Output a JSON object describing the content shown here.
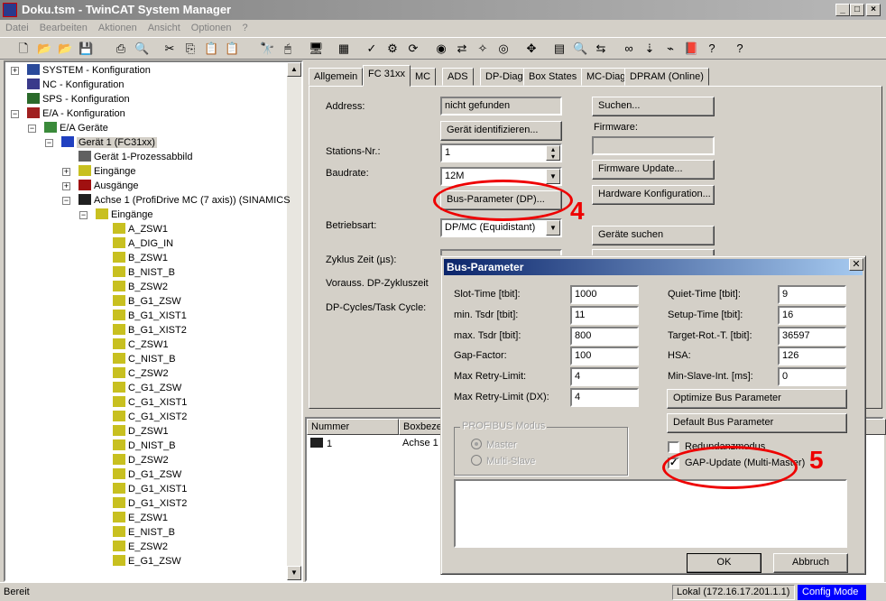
{
  "window": {
    "title": "Doku.tsm - TwinCAT System Manager",
    "controls": [
      "_",
      "□",
      "×"
    ]
  },
  "menu": [
    "Datei",
    "Bearbeiten",
    "Aktionen",
    "Ansicht",
    "Optionen",
    "?"
  ],
  "toolbar": [
    {
      "icon": "new-icon",
      "glyph": "🗋"
    },
    {
      "icon": "open-icon",
      "glyph": "📂"
    },
    {
      "icon": "open-remote-icon",
      "glyph": "📂"
    },
    {
      "icon": "save-icon",
      "glyph": "💾"
    },
    {
      "icon": "print-icon",
      "glyph": "⎙"
    },
    {
      "icon": "print-preview-icon",
      "glyph": "🔍"
    },
    {
      "icon": "cut-icon",
      "glyph": "✂"
    },
    {
      "icon": "copy-icon",
      "glyph": "⎘"
    },
    {
      "icon": "paste-icon",
      "glyph": "📋"
    },
    {
      "icon": "paste-with-links-icon",
      "glyph": "📋"
    },
    {
      "icon": "find-icon",
      "glyph": "🔭"
    },
    {
      "icon": "mouse-icon",
      "glyph": "🖱"
    },
    {
      "icon": "target-system-icon",
      "glyph": "🖥"
    },
    {
      "icon": "generate-mappings-icon",
      "glyph": "▦"
    },
    {
      "icon": "check-configuration-icon",
      "glyph": "✓"
    },
    {
      "icon": "activate-configuration-icon",
      "glyph": "⚙"
    },
    {
      "icon": "restart-config-mode-icon",
      "glyph": "⟳"
    },
    {
      "icon": "reload-devices-icon",
      "glyph": "◉"
    },
    {
      "icon": "scan-devices-icon",
      "glyph": "⇄"
    },
    {
      "icon": "toggle-free-run-icon",
      "glyph": "✧"
    },
    {
      "icon": "show-online-icon",
      "glyph": "◎"
    },
    {
      "icon": "select-in-tree-icon",
      "glyph": "✥"
    },
    {
      "icon": "table-icon",
      "glyph": "▤"
    },
    {
      "icon": "zoom-icon",
      "glyph": "🔍"
    },
    {
      "icon": "link-icon",
      "glyph": "⇆"
    },
    {
      "icon": "watch-icon",
      "glyph": "∞"
    },
    {
      "icon": "force-icon",
      "glyph": "⇣"
    },
    {
      "icon": "online-values-icon",
      "glyph": "⌁"
    },
    {
      "icon": "help-book-icon",
      "glyph": "📕"
    },
    {
      "icon": "help-icon",
      "glyph": "?"
    },
    {
      "icon": "whats-this-icon",
      "glyph": "?"
    }
  ],
  "tree": [
    {
      "label": "SYSTEM - Konfiguration",
      "level": 0,
      "expander": "+",
      "icon": "system-icon",
      "color": "#2a4a9a"
    },
    {
      "label": "NC - Konfiguration",
      "level": 0,
      "expander": "",
      "icon": "nc-icon",
      "color": "#3a3a8a"
    },
    {
      "label": "SPS - Konfiguration",
      "level": 0,
      "expander": "",
      "icon": "plc-icon",
      "color": "#2a6a2a"
    },
    {
      "label": "E/A - Konfiguration",
      "level": 0,
      "expander": "-",
      "icon": "io-config-icon",
      "color": "#a02020"
    },
    {
      "label": "E/A Geräte",
      "level": 1,
      "expander": "-",
      "icon": "io-devices-icon",
      "color": "#3a8a3a"
    },
    {
      "label": "Gerät 1 (FC31xx)",
      "level": 2,
      "expander": "-",
      "icon": "profibus-device-icon",
      "color": "#2040c0",
      "selected": true
    },
    {
      "label": "Gerät 1-Prozessabbild",
      "level": 3,
      "expander": "",
      "icon": "process-image-icon",
      "color": "#606060"
    },
    {
      "label": "Eingänge",
      "level": 3,
      "expander": "+",
      "icon": "inputs-icon",
      "color": "#c8c020"
    },
    {
      "label": "Ausgänge",
      "level": 3,
      "expander": "+",
      "icon": "outputs-icon",
      "color": "#a01010"
    },
    {
      "label": "Achse 1 (ProfiDrive MC (7 axis)) (SINAMICS",
      "level": 3,
      "expander": "-",
      "icon": "axis-box-icon",
      "color": "#202020"
    },
    {
      "label": "Eingänge",
      "level": 4,
      "expander": "-",
      "icon": "inputs-icon",
      "color": "#c8c020"
    },
    {
      "label": "A_ZSW1",
      "level": 5,
      "icon": "input-var-icon",
      "color": "#c8c020"
    },
    {
      "label": "A_DIG_IN",
      "level": 5,
      "icon": "input-var-icon",
      "color": "#c8c020"
    },
    {
      "label": "B_ZSW1",
      "level": 5,
      "icon": "input-var-icon",
      "color": "#c8c020"
    },
    {
      "label": "B_NIST_B",
      "level": 5,
      "icon": "input-var-icon",
      "color": "#c8c020"
    },
    {
      "label": "B_ZSW2",
      "level": 5,
      "icon": "input-var-icon",
      "color": "#c8c020"
    },
    {
      "label": "B_G1_ZSW",
      "level": 5,
      "icon": "input-var-icon",
      "color": "#c8c020"
    },
    {
      "label": "B_G1_XIST1",
      "level": 5,
      "icon": "input-var-icon",
      "color": "#c8c020"
    },
    {
      "label": "B_G1_XIST2",
      "level": 5,
      "icon": "input-var-icon",
      "color": "#c8c020"
    },
    {
      "label": "C_ZSW1",
      "level": 5,
      "icon": "input-var-icon",
      "color": "#c8c020"
    },
    {
      "label": "C_NIST_B",
      "level": 5,
      "icon": "input-var-icon",
      "color": "#c8c020"
    },
    {
      "label": "C_ZSW2",
      "level": 5,
      "icon": "input-var-icon",
      "color": "#c8c020"
    },
    {
      "label": "C_G1_ZSW",
      "level": 5,
      "icon": "input-var-icon",
      "color": "#c8c020"
    },
    {
      "label": "C_G1_XIST1",
      "level": 5,
      "icon": "input-var-icon",
      "color": "#c8c020"
    },
    {
      "label": "C_G1_XIST2",
      "level": 5,
      "icon": "input-var-icon",
      "color": "#c8c020"
    },
    {
      "label": "D_ZSW1",
      "level": 5,
      "icon": "input-var-icon",
      "color": "#c8c020"
    },
    {
      "label": "D_NIST_B",
      "level": 5,
      "icon": "input-var-icon",
      "color": "#c8c020"
    },
    {
      "label": "D_ZSW2",
      "level": 5,
      "icon": "input-var-icon",
      "color": "#c8c020"
    },
    {
      "label": "D_G1_ZSW",
      "level": 5,
      "icon": "input-var-icon",
      "color": "#c8c020"
    },
    {
      "label": "D_G1_XIST1",
      "level": 5,
      "icon": "input-var-icon",
      "color": "#c8c020"
    },
    {
      "label": "D_G1_XIST2",
      "level": 5,
      "icon": "input-var-icon",
      "color": "#c8c020"
    },
    {
      "label": "E_ZSW1",
      "level": 5,
      "icon": "input-var-icon",
      "color": "#c8c020"
    },
    {
      "label": "E_NIST_B",
      "level": 5,
      "icon": "input-var-icon",
      "color": "#c8c020"
    },
    {
      "label": "E_ZSW2",
      "level": 5,
      "icon": "input-var-icon",
      "color": "#c8c020"
    },
    {
      "label": "E_G1_ZSW",
      "level": 5,
      "icon": "input-var-icon",
      "color": "#c8c020"
    }
  ],
  "tabs": {
    "items": [
      "Allgemein",
      "FC 31xx",
      "MC",
      "ADS",
      "DP-Diag",
      "Box States",
      "MC-Diag",
      "DPRAM (Online)"
    ],
    "active": "FC 31xx"
  },
  "fc31xx": {
    "address_label": "Address:",
    "address_value": "nicht gefunden",
    "identify_button": "Gerät identifizieren...",
    "station_label": "Stations-Nr.:",
    "station_value": "1",
    "baudrate_label": "Baudrate:",
    "baudrate_value": "12M",
    "bus_param_button": "Bus-Parameter (DP)...",
    "mode_label": "Betriebsart:",
    "mode_value": "DP/MC (Equidistant)",
    "cycle_label": "Zyklus Zeit (µs):",
    "expected_cycle_label": "Vorauss. DP-Zykluszeit",
    "dp_cycles_label": "DP-Cycles/Task Cycle:",
    "search_button": "Suchen...",
    "firmware_label": "Firmware:",
    "firmware_value": "",
    "firmware_update_button": "Firmware Update...",
    "hw_config_button": "Hardware Konfiguration...",
    "find_devices_button": "Geräte suchen"
  },
  "box_list": {
    "columns": [
      "Nummer",
      "Boxbeze"
    ],
    "rows": [
      {
        "number": "1",
        "name": "Achse 1"
      }
    ]
  },
  "dialog": {
    "title": "Bus-Parameter",
    "left_fields": [
      {
        "label": "Slot-Time [tbit]:",
        "value": "1000"
      },
      {
        "label": "min. Tsdr [tbit]:",
        "value": "11"
      },
      {
        "label": "max. Tsdr [tbit]:",
        "value": "800"
      },
      {
        "label": "Gap-Factor:",
        "value": "100"
      },
      {
        "label": "Max Retry-Limit:",
        "value": "4"
      },
      {
        "label": "Max Retry-Limit (DX):",
        "value": "4"
      }
    ],
    "right_fields": [
      {
        "label": "Quiet-Time [tbit]:",
        "value": "9"
      },
      {
        "label": "Setup-Time [tbit]:",
        "value": "16"
      },
      {
        "label": "Target-Rot.-T. [tbit]:",
        "value": "36597"
      },
      {
        "label": "HSA:",
        "value": "126"
      },
      {
        "label": "Min-Slave-Int. [ms]:",
        "value": "0"
      }
    ],
    "optimize_button": "Optimize Bus Parameter",
    "default_button": "Default Bus Parameter",
    "profibus_group": "PROFIBUS Modus",
    "radio_master": "Master",
    "radio_multislave": "Multi-Slave",
    "radio_selected": "Master",
    "redundancy_label": "Redundanzmodus",
    "redundancy_checked": false,
    "gap_update_label": "GAP-Update (Multi-Master)",
    "gap_update_checked": true,
    "ok_button": "OK",
    "cancel_button": "Abbruch"
  },
  "annotations": {
    "step4": "4",
    "step5": "5",
    "color": "#e00000"
  },
  "status": {
    "left": "Bereit",
    "connection": "Lokal (172.16.17.201.1.1)",
    "mode": "Config Mode",
    "mode_bg": "#0000ff"
  }
}
